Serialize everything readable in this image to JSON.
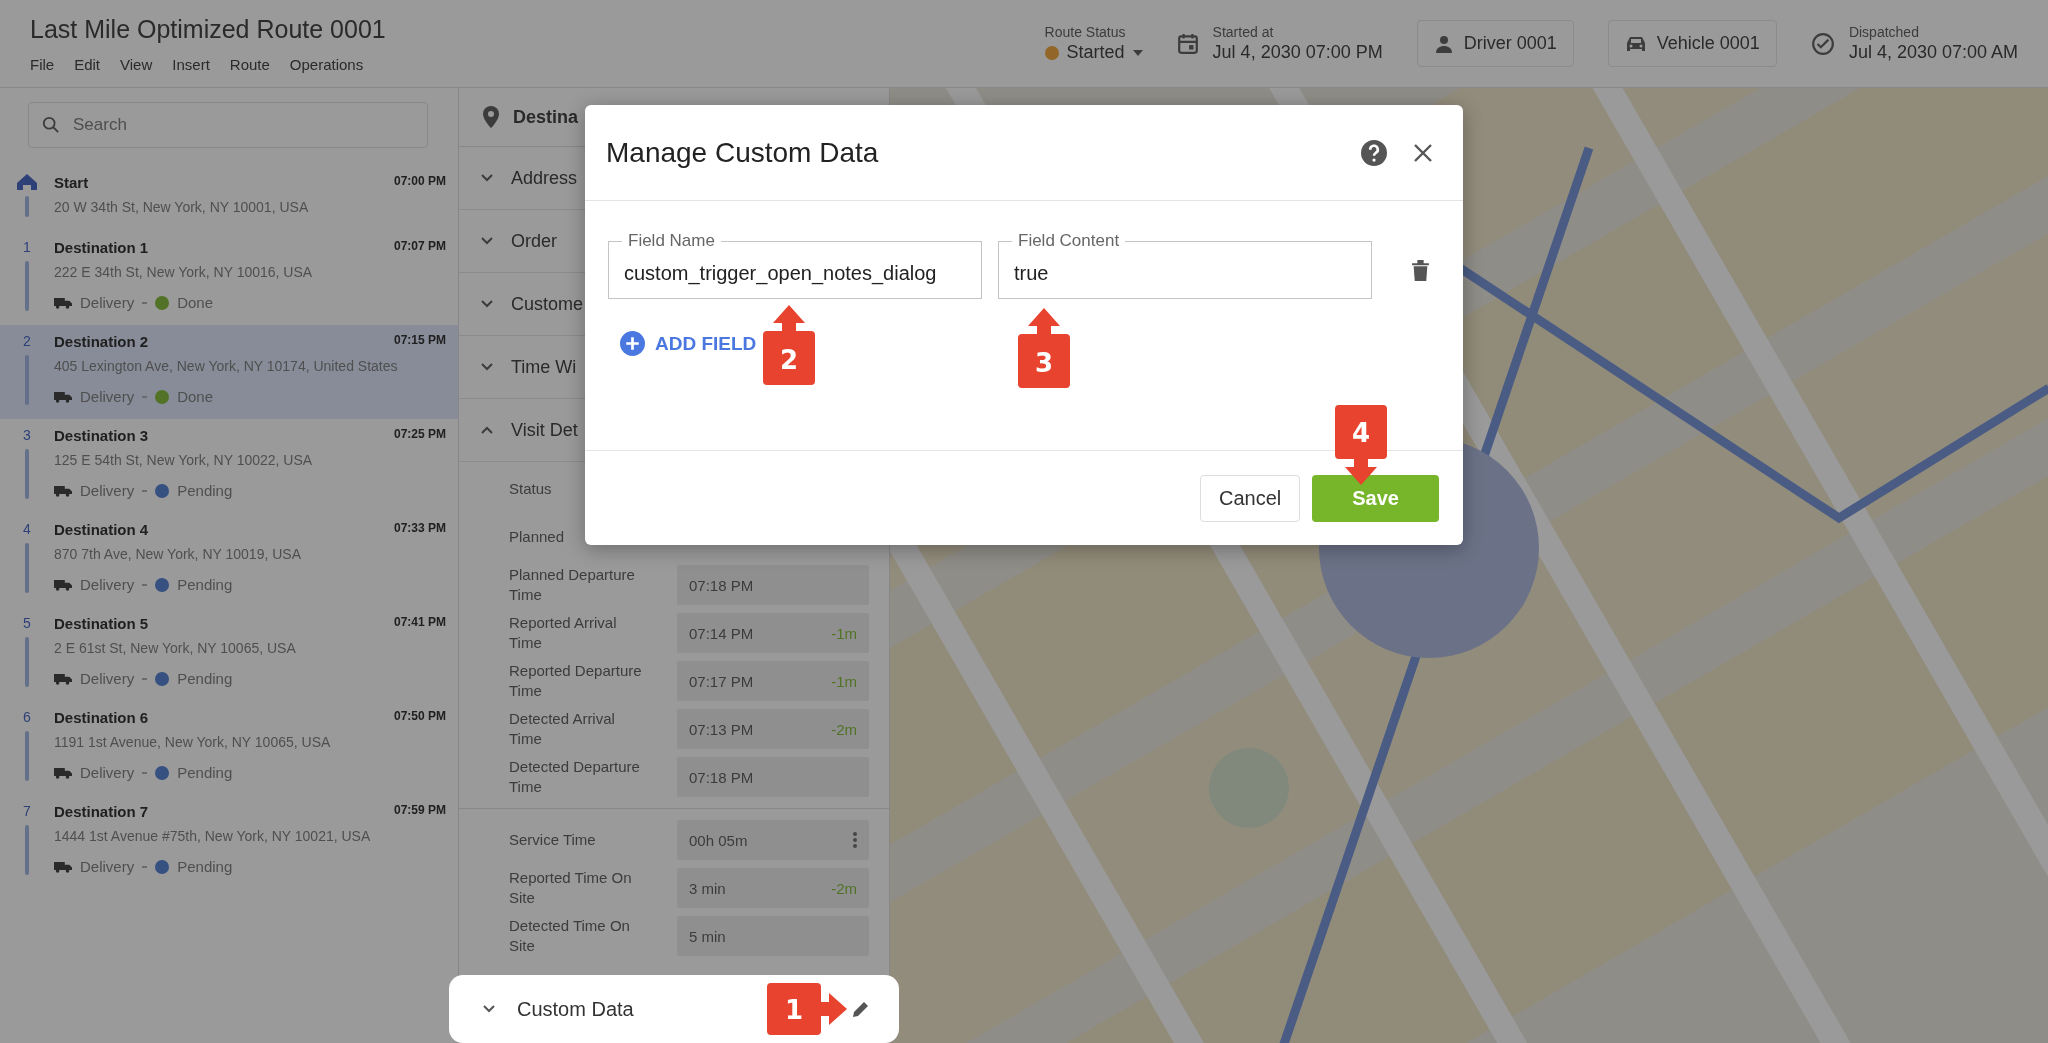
{
  "header": {
    "title": "Last Mile Optimized Route 0001",
    "menu": [
      "File",
      "Edit",
      "View",
      "Insert",
      "Route",
      "Operations"
    ],
    "route_status": {
      "label": "Route Status",
      "value": "Started",
      "color": "#926628"
    },
    "started_at": {
      "label": "Started at",
      "value": "Jul 4, 2030 07:00 PM"
    },
    "driver": "Driver 0001",
    "vehicle": "Vehicle 0001",
    "dispatched": {
      "label": "Dispatched",
      "value": "Jul 4, 2030 07:00 AM"
    }
  },
  "search": {
    "placeholder": "Search"
  },
  "stops": [
    {
      "kind": "start",
      "name": "Start",
      "time": "07:00 PM",
      "address": "20 W 34th St, New York, NY 10001, USA",
      "selected": false
    },
    {
      "kind": "destination",
      "number": "1",
      "name": "Destination 1",
      "time": "07:07 PM",
      "address": "222 E 34th St, New York, NY 10016, USA",
      "type": "Delivery",
      "status": "Done",
      "color": "#527327",
      "selected": false
    },
    {
      "kind": "destination",
      "number": "2",
      "name": "Destination 2",
      "time": "07:15 PM",
      "address": "405 Lexington Ave, New York, NY 10174, United States",
      "type": "Delivery",
      "status": "Done",
      "color": "#527327",
      "selected": true
    },
    {
      "kind": "destination",
      "number": "3",
      "name": "Destination 3",
      "time": "07:25 PM",
      "address": "125 E 54th St, New York, NY 10022, USA",
      "type": "Delivery",
      "status": "Pending",
      "color": "#36507f",
      "selected": false
    },
    {
      "kind": "destination",
      "number": "4",
      "name": "Destination 4",
      "time": "07:33 PM",
      "address": "870 7th Ave, New York, NY 10019, USA",
      "type": "Delivery",
      "status": "Pending",
      "color": "#36507f",
      "selected": false
    },
    {
      "kind": "destination",
      "number": "5",
      "name": "Destination 5",
      "time": "07:41 PM",
      "address": "2 E 61st St, New York, NY 10065, USA",
      "type": "Delivery",
      "status": "Pending",
      "color": "#36507f",
      "selected": false
    },
    {
      "kind": "destination",
      "number": "6",
      "name": "Destination 6",
      "time": "07:50 PM",
      "address": "1191 1st Avenue, New York, NY 10065, USA",
      "type": "Delivery",
      "status": "Pending",
      "color": "#36507f",
      "selected": false
    },
    {
      "kind": "destination",
      "number": "7",
      "name": "Destination 7",
      "time": "07:59 PM",
      "address": "1444 1st Avenue #75th, New York, NY 10021, USA",
      "type": "Delivery",
      "status": "Pending",
      "color": "#36507f",
      "selected": false
    }
  ],
  "detail_panel": {
    "title": "Destina",
    "sections": [
      {
        "label": "Address",
        "expanded": false
      },
      {
        "label": "Order",
        "expanded": false
      },
      {
        "label": "Custome",
        "expanded": false
      },
      {
        "label": "Time Wi",
        "expanded": false
      },
      {
        "label": "Visit Det",
        "expanded": true
      }
    ],
    "fields": [
      {
        "label": "Status"
      },
      {
        "label": "Planned"
      },
      {
        "label": "Planned Departure Time",
        "value": "07:18 PM"
      },
      {
        "label": "Reported Arrival Time",
        "value": "07:14 PM",
        "delta": "-1m"
      },
      {
        "label": "Reported Departure Time",
        "value": "07:17 PM",
        "delta": "-1m"
      },
      {
        "label": "Detected Arrival Time",
        "value": "07:13 PM",
        "delta": "-2m"
      },
      {
        "label": "Detected Departure Time",
        "value": "07:18 PM"
      },
      {
        "label": "Service Time",
        "value": "00h 05m",
        "menu": true
      },
      {
        "label": "Reported Time On Site",
        "value": "3 min",
        "delta": "-2m"
      },
      {
        "label": "Detected Time On Site",
        "value": "5 min"
      }
    ],
    "custom_data": {
      "label": "Custom Data",
      "expanded": false
    }
  },
  "dialog": {
    "title": "Manage Custom Data",
    "rows": [
      {
        "name_label": "Field Name",
        "name_value": "custom_trigger_open_notes_dialog",
        "content_label": "Field Content",
        "content_value": "true"
      }
    ],
    "add_label": "ADD FIELD",
    "cancel": "Cancel",
    "save": "Save"
  },
  "callouts": [
    {
      "number": "1",
      "kind": "right"
    },
    {
      "number": "2",
      "kind": "up"
    },
    {
      "number": "3",
      "kind": "up"
    },
    {
      "number": "4",
      "kind": "down"
    }
  ]
}
